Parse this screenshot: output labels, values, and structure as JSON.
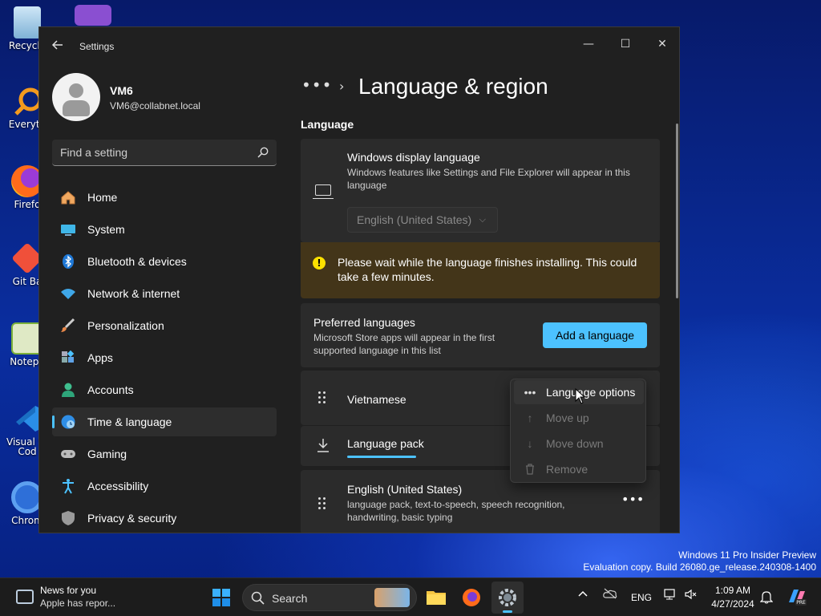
{
  "desktop": {
    "icons": [
      {
        "label": "Recycle",
        "icon": "recycle-bin-icon"
      },
      {
        "label": "Everyth",
        "icon": "everything-search-icon"
      },
      {
        "label": "Firefo",
        "icon": "firefox-icon"
      },
      {
        "label": "Git Ba",
        "icon": "git-bash-icon"
      },
      {
        "label": "Notepa",
        "icon": "notepad-plus-plus-icon"
      },
      {
        "label": "Visual St",
        "label2": "Cod",
        "icon": "vscode-icon"
      },
      {
        "label": "Chrom",
        "icon": "chrome-icon"
      }
    ]
  },
  "window": {
    "title": "Settings",
    "controls": {
      "minimize": "—",
      "maximize": "☐",
      "close": "✕"
    }
  },
  "profile": {
    "name": "VM6",
    "email": "VM6@collabnet.local"
  },
  "search": {
    "placeholder": "Find a setting"
  },
  "nav": {
    "items": [
      {
        "label": "Home",
        "icon": "home-icon"
      },
      {
        "label": "System",
        "icon": "system-icon"
      },
      {
        "label": "Bluetooth & devices",
        "icon": "bluetooth-icon"
      },
      {
        "label": "Network & internet",
        "icon": "wifi-icon"
      },
      {
        "label": "Personalization",
        "icon": "brush-icon"
      },
      {
        "label": "Apps",
        "icon": "apps-icon"
      },
      {
        "label": "Accounts",
        "icon": "accounts-icon"
      },
      {
        "label": "Time & language",
        "icon": "globe-clock-icon",
        "selected": true
      },
      {
        "label": "Gaming",
        "icon": "gamepad-icon"
      },
      {
        "label": "Accessibility",
        "icon": "accessibility-icon"
      },
      {
        "label": "Privacy & security",
        "icon": "shield-icon"
      }
    ]
  },
  "page": {
    "breadcrumb_more": "•••",
    "breadcrumb_separator": "›",
    "title": "Language & region",
    "section": "Language"
  },
  "display_language": {
    "title": "Windows display language",
    "description": "Windows features like Settings and File Explorer will appear in this language",
    "selected": "English (United States)"
  },
  "warning": {
    "icon": "!",
    "text": "Please wait while the language finishes installing. This could take a few minutes.",
    "color": "#fce100"
  },
  "preferred": {
    "title": "Preferred languages",
    "description": "Microsoft Store apps will appear in the first supported language in this list",
    "add_button": "Add a language"
  },
  "languages": {
    "vietnamese": {
      "name": "Vietnamese"
    },
    "language_pack": {
      "label": "Language pack"
    },
    "english": {
      "name": "English (United States)",
      "description": "language pack, text-to-speech, speech recognition, handwriting, basic typing",
      "more": "•••"
    }
  },
  "context_menu": {
    "items": [
      {
        "label": "Language options",
        "icon": "•••",
        "enabled": true
      },
      {
        "label": "Move up",
        "icon": "↑",
        "enabled": false
      },
      {
        "label": "Move down",
        "icon": "↓",
        "enabled": false
      },
      {
        "label": "Remove",
        "icon": "🗑",
        "enabled": false
      }
    ]
  },
  "watermark": {
    "line1": "Windows 11 Pro Insider Preview",
    "line2": "Evaluation copy. Build 26080.ge_release.240308-1400"
  },
  "taskbar": {
    "news_title": "News for you",
    "news_subtitle": "Apple has repor...",
    "search_label": "Search",
    "input_lang": "ENG",
    "time": "1:09 AM",
    "date": "4/27/2024"
  },
  "colors": {
    "accent": "#4cc2ff",
    "warning_bg": "#433519",
    "window_bg": "#202020",
    "card_bg": "#2b2b2b"
  }
}
